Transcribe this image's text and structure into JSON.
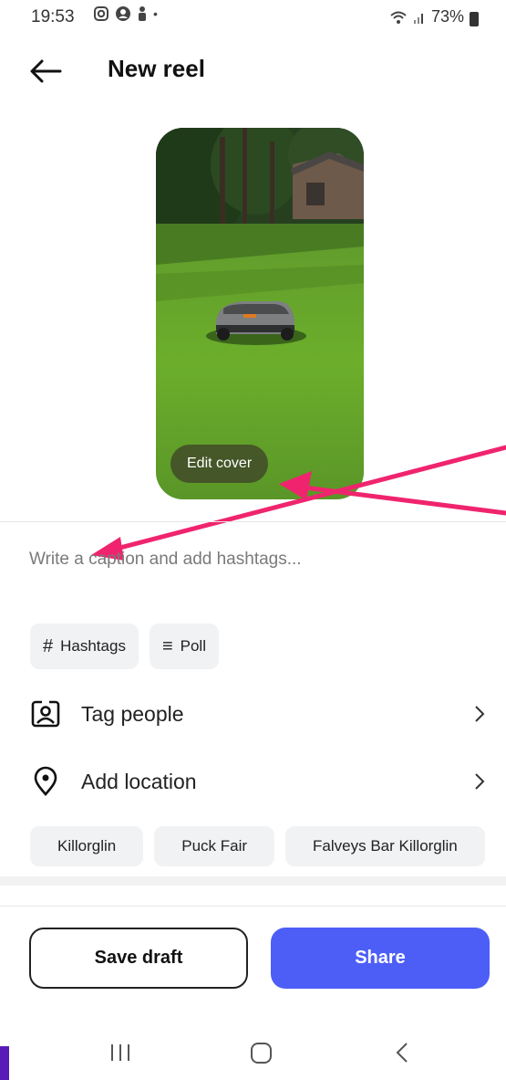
{
  "status_bar": {
    "time": "19:53",
    "battery": "73%"
  },
  "header": {
    "title": "New reel"
  },
  "cover": {
    "edit_label": "Edit cover"
  },
  "caption": {
    "placeholder": "Write a caption and add hashtags..."
  },
  "chips": {
    "hashtags_icon": "#",
    "hashtags_label": "Hashtags",
    "poll_icon": "≡",
    "poll_label": "Poll"
  },
  "rows": {
    "tag_people": "Tag people",
    "add_location": "Add location"
  },
  "location_suggestions": [
    "Killorglin",
    "Puck Fair",
    "Falveys Bar Killorglin"
  ],
  "actions": {
    "save_draft": "Save draft",
    "share": "Share"
  },
  "colors": {
    "accent": "#4d5ef7",
    "annotation": "#f0246e"
  }
}
